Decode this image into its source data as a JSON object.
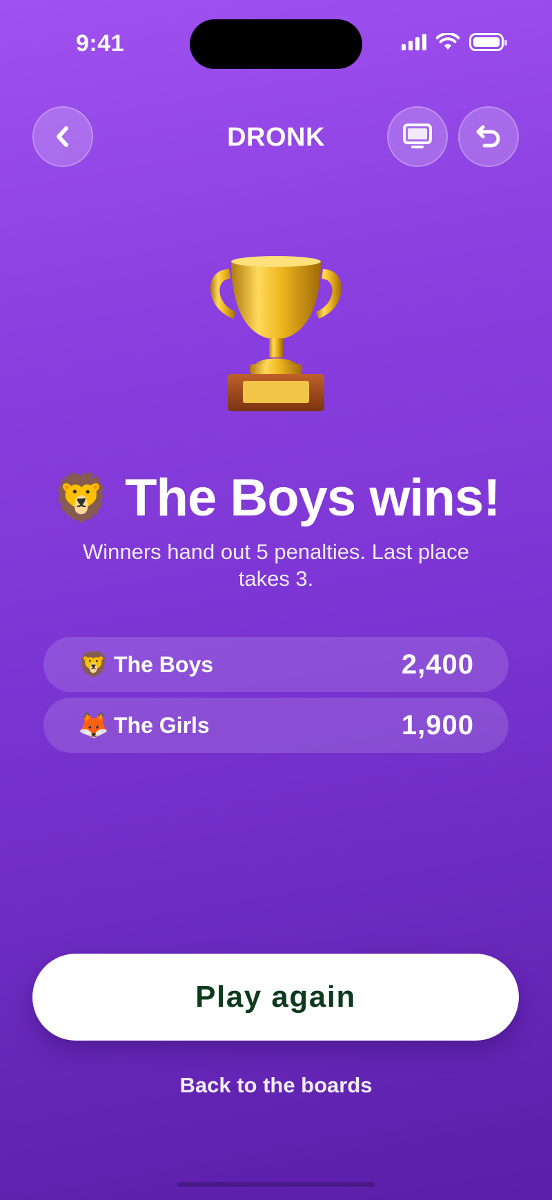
{
  "status_bar": {
    "time": "9:41"
  },
  "nav": {
    "title": "DRONK",
    "back_icon": "chevron-left-icon",
    "tv_icon": "monitor-icon",
    "undo_icon": "undo-arrow-icon"
  },
  "result": {
    "trophy_icon": "trophy-icon",
    "winner_emoji": "🦁",
    "heading": "The Boys wins!",
    "subtitle": "Winners hand out 5 penalties. Last place takes 3."
  },
  "scores": [
    {
      "emoji": "🦁",
      "name": "The Boys",
      "score": "2,400"
    },
    {
      "emoji": "🦊",
      "name": "The Girls",
      "score": "1,900"
    }
  ],
  "actions": {
    "play_again": "Play again",
    "back_to_boards": "Back to the boards"
  },
  "colors": {
    "background_top": "#a052f0",
    "background_bottom": "#5a1ea8",
    "play_button_text": "#0e3a1e"
  }
}
